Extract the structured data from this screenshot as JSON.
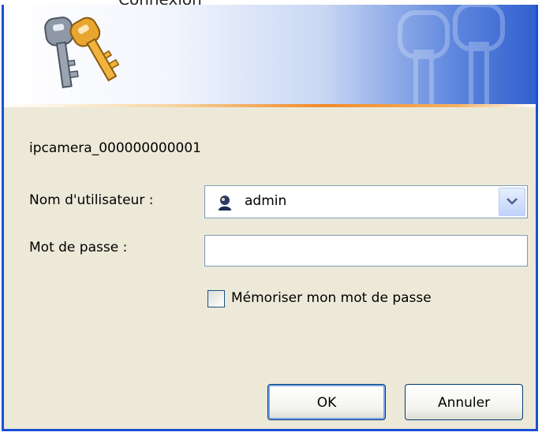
{
  "window": {
    "title": "Connexion"
  },
  "dialog": {
    "realm": "ipcamera_000000000001",
    "username_label": "Nom d'utilisateur :",
    "username_value": "admin",
    "password_label": "Mot de passe :",
    "password_value": "",
    "remember_label": "Mémoriser mon mot de passe",
    "remember_checked": false,
    "ok_label": "OK",
    "cancel_label": "Annuler"
  },
  "icons": {
    "banner": "keys-icon",
    "user": "user-icon",
    "dropdown": "chevron-down-icon"
  },
  "colors": {
    "frame": "#1a4fd6",
    "dialog_bg": "#ece9d8",
    "accent_line": "#f08a28"
  }
}
